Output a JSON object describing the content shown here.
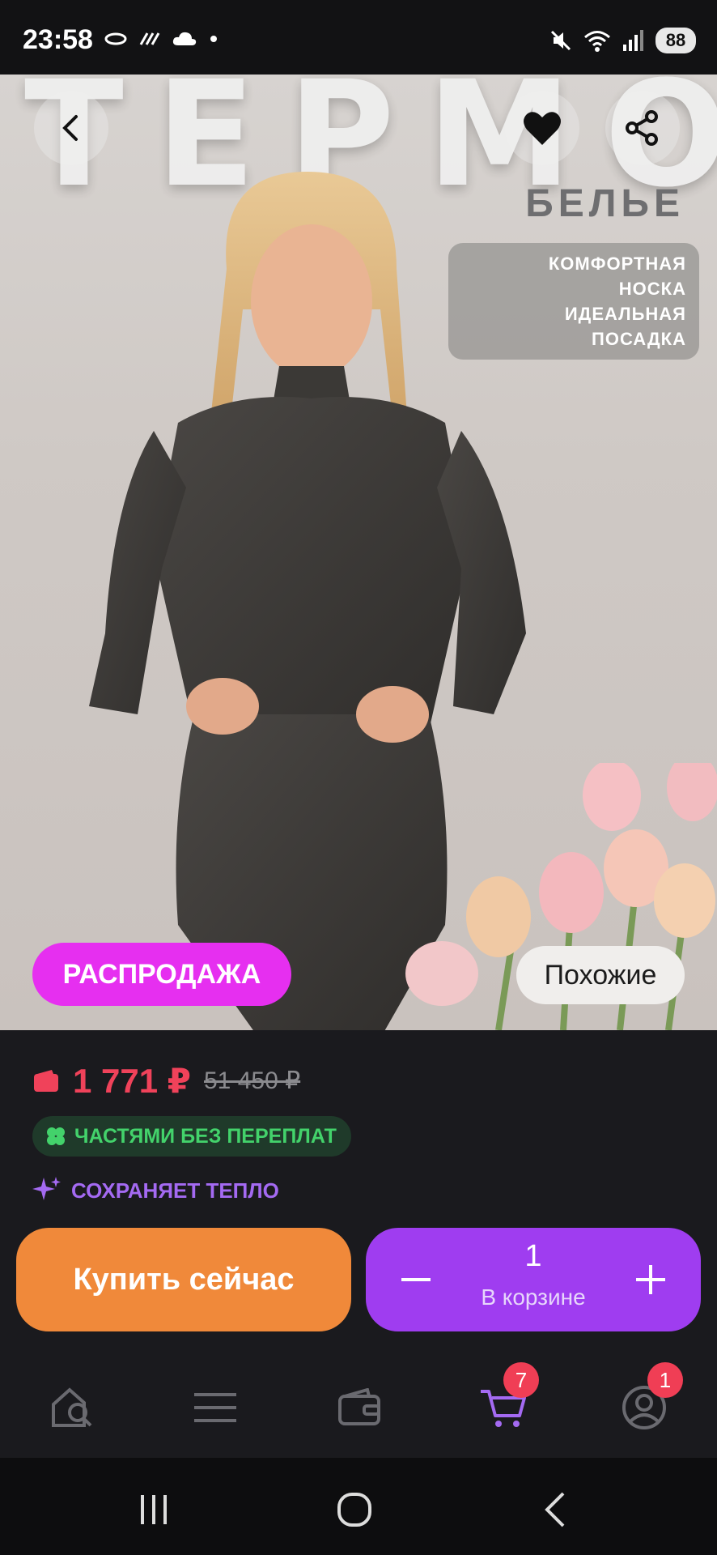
{
  "status_bar": {
    "time": "23:58",
    "battery": "88",
    "icons": [
      "oval-icon",
      "signal-lines-icon",
      "cloud-icon",
      "dot-icon",
      "mute-icon",
      "wifi-icon",
      "cell-signal-icon"
    ]
  },
  "hero": {
    "banner_title": "ТЕРМО",
    "banner_subtitle": "БЕЛЬЕ",
    "features": [
      "КОМФОРТНАЯ",
      "НОСКА",
      "ИДЕАЛЬНАЯ",
      "ПОСАДКА"
    ],
    "sale_badge": "РАСПРОДАЖА",
    "similar_button": "Похожие"
  },
  "price": {
    "current": "1 771 ₽",
    "old": "51 450 ₽",
    "installments": "ЧАСТЯМИ БЕЗ ПЕРЕПЛАТ",
    "feature_tag": "СОХРАНЯЕТ ТЕПЛО"
  },
  "actions": {
    "buy_now": "Купить сейчас",
    "quantity": "1",
    "in_cart": "В корзине"
  },
  "bottom_nav": {
    "cart_badge": "7",
    "profile_badge": "1"
  },
  "colors": {
    "accent_purple": "#9f3df0",
    "buy_orange": "#f0893a",
    "sale_pink": "#e62ff0",
    "price_red": "#f0425a",
    "installments_green": "#43d26b"
  }
}
